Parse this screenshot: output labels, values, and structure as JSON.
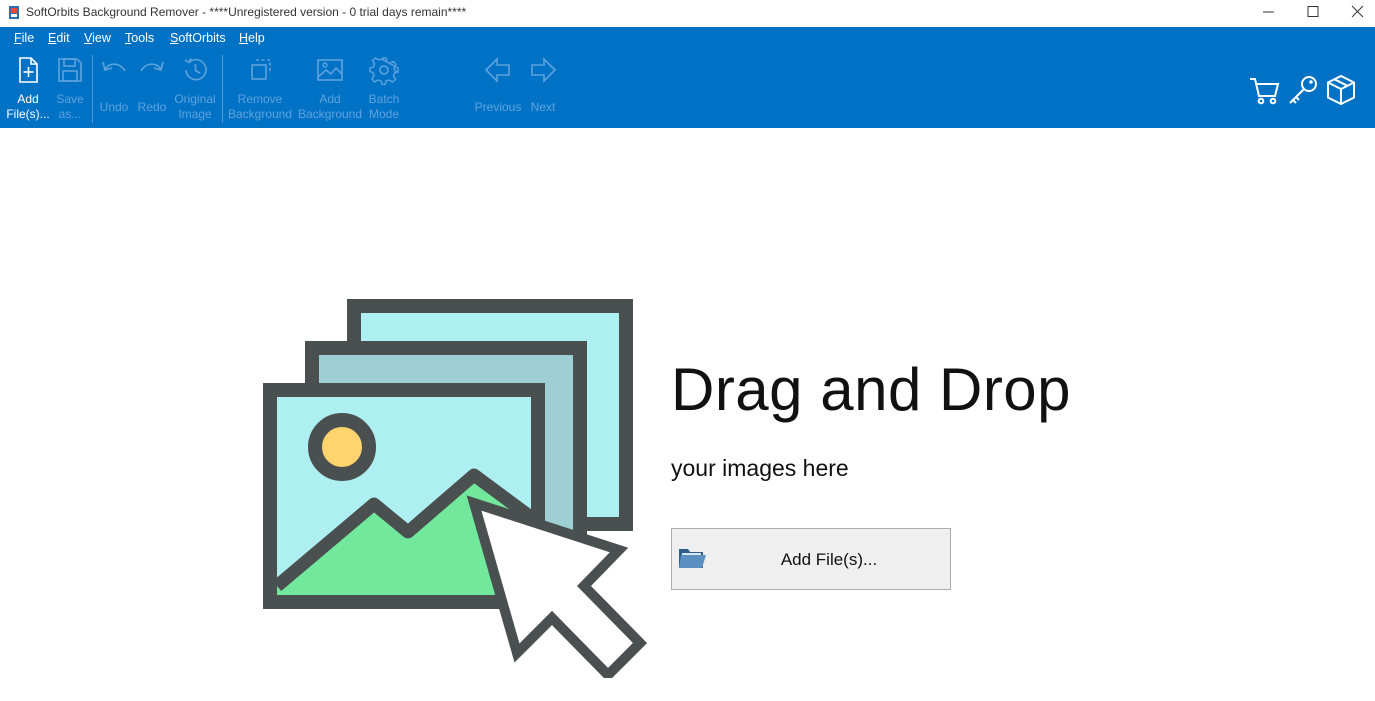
{
  "window": {
    "title": "SoftOrbits Background Remover - ****Unregistered version - 0 trial days remain****"
  },
  "menu": {
    "items": [
      "File",
      "Edit",
      "View",
      "Tools",
      "SoftOrbits",
      "Help"
    ]
  },
  "toolbar": {
    "add_files": "Add\nFile(s)...",
    "save_as": "Save\nas...",
    "undo": "Undo",
    "redo": "Redo",
    "original_image": "Original\nImage",
    "remove_background": "Remove\nBackground",
    "add_background": "Add\nBackground",
    "batch_mode": "Batch\nMode",
    "previous": "Previous",
    "next": "Next"
  },
  "right_icons": [
    "cart-icon",
    "key-icon",
    "box-icon"
  ],
  "main": {
    "headline": "Drag and Drop",
    "subline": "your images here",
    "add_button_label": "Add File(s)..."
  },
  "colors": {
    "ribbon": "#0072c6",
    "disabled_label": "#5fa3dd",
    "frame_dark": "#4a4f4f",
    "sky_light": "#aef0f2",
    "sky_mid": "#9ecfd4",
    "sun": "#ffd36e",
    "mountain": "#72e89c"
  }
}
